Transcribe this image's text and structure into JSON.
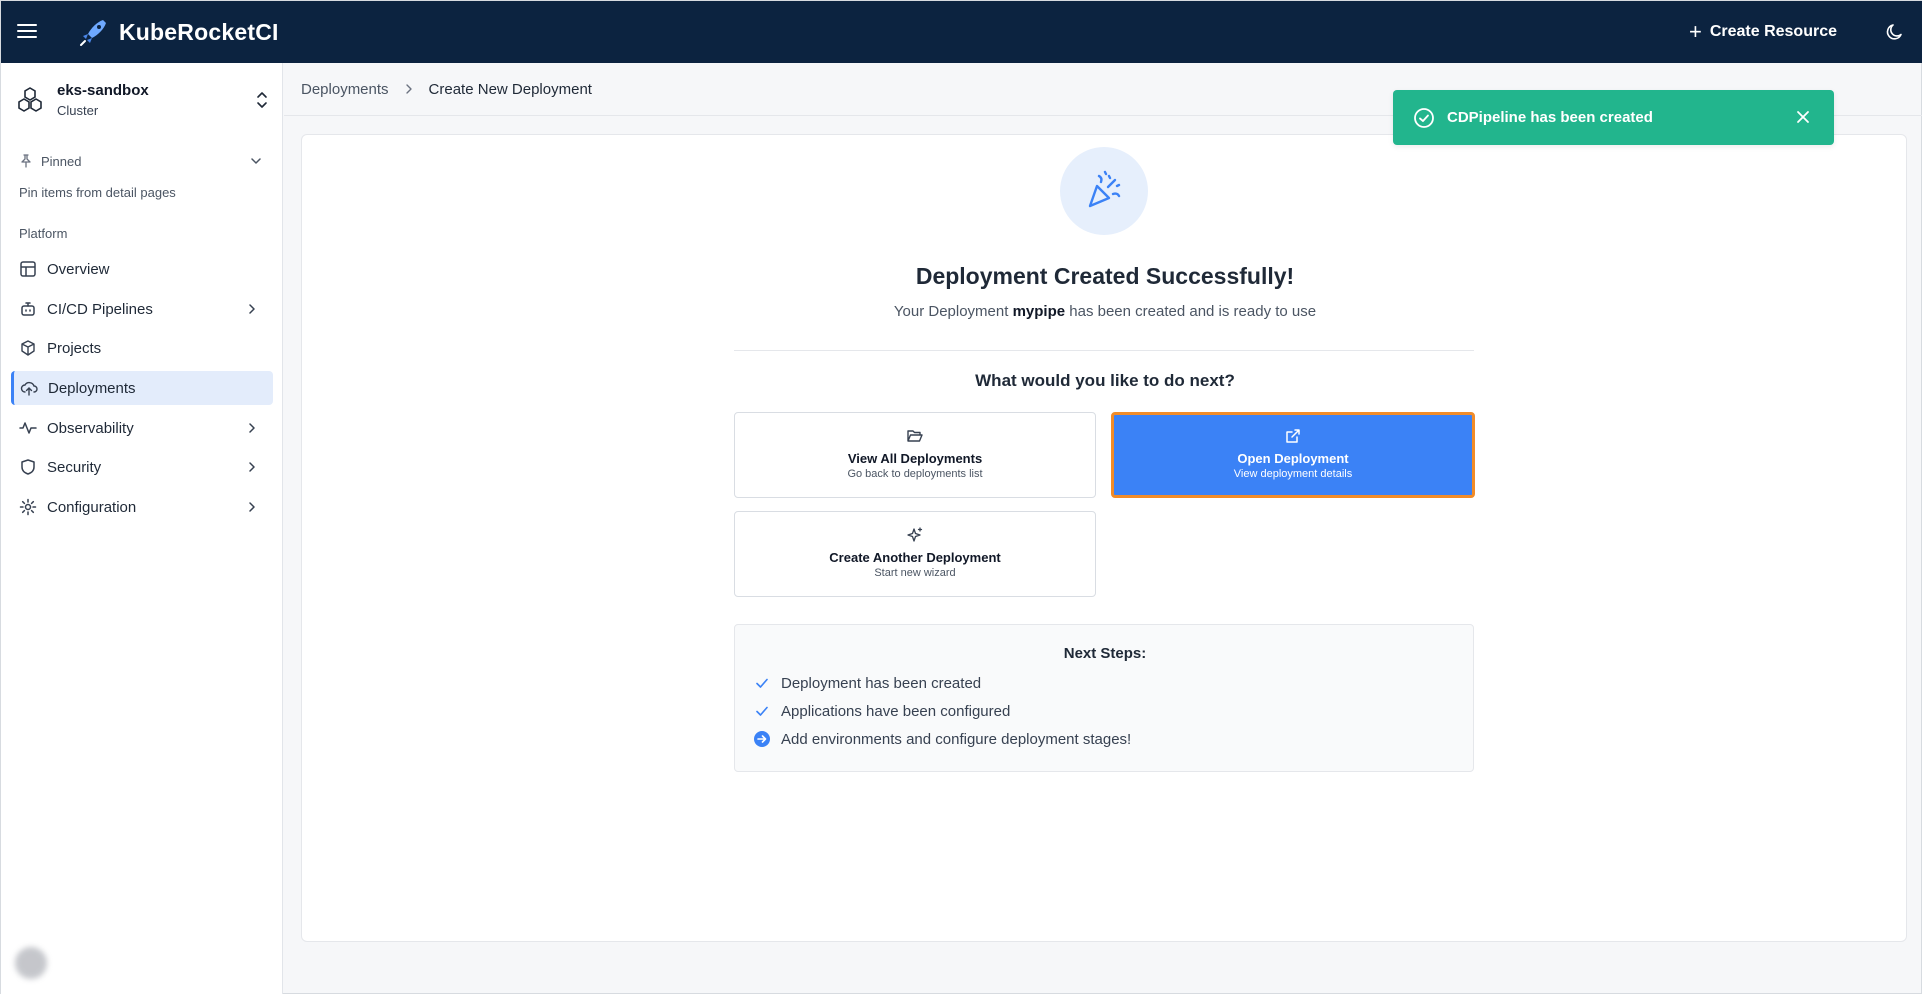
{
  "app": {
    "name": "KubeRocketCI",
    "create_resource_label": "Create Resource"
  },
  "cluster": {
    "name": "eks-sandbox",
    "type": "Cluster"
  },
  "sidebar": {
    "pinned_label": "Pinned",
    "pinned_hint": "Pin items from detail pages",
    "section_label": "Platform",
    "items": [
      {
        "label": "Overview",
        "icon": "layout-icon",
        "has_children": false
      },
      {
        "label": "CI/CD Pipelines",
        "icon": "bot-icon",
        "has_children": true
      },
      {
        "label": "Projects",
        "icon": "box-icon",
        "has_children": false
      },
      {
        "label": "Deployments",
        "icon": "cloud-upload-icon",
        "has_children": false,
        "active": true
      },
      {
        "label": "Observability",
        "icon": "activity-icon",
        "has_children": true
      },
      {
        "label": "Security",
        "icon": "shield-icon",
        "has_children": true
      },
      {
        "label": "Configuration",
        "icon": "gear-icon",
        "has_children": true
      }
    ]
  },
  "breadcrumb": {
    "parent": "Deployments",
    "current": "Create New Deployment"
  },
  "success": {
    "title": "Deployment Created Successfully!",
    "sub_prefix": "Your Deployment",
    "deployment_name": "mypipe",
    "sub_suffix": "has been created and is ready to use",
    "next_question": "What would you like to do next?"
  },
  "actions": {
    "view_all": {
      "title": "View All Deployments",
      "subtitle": "Go back to deployments list",
      "icon": "folder-open-icon"
    },
    "open": {
      "title": "Open Deployment",
      "subtitle": "View deployment details",
      "icon": "external-link-icon"
    },
    "create_another": {
      "title": "Create Another Deployment",
      "subtitle": "Start new wizard",
      "icon": "sparkles-icon"
    }
  },
  "next_steps": {
    "title": "Next Steps:",
    "items": [
      {
        "text": "Deployment has been created",
        "status": "done"
      },
      {
        "text": "Applications have been configured",
        "status": "done"
      },
      {
        "text": "Add environments and configure deployment stages!",
        "status": "next"
      }
    ]
  },
  "toast": {
    "message": "CDPipeline has been created"
  },
  "colors": {
    "topbar": "#0c2340",
    "accent": "#3b82f6",
    "toast": "#22b58d",
    "focus_outline": "#f28c28"
  }
}
